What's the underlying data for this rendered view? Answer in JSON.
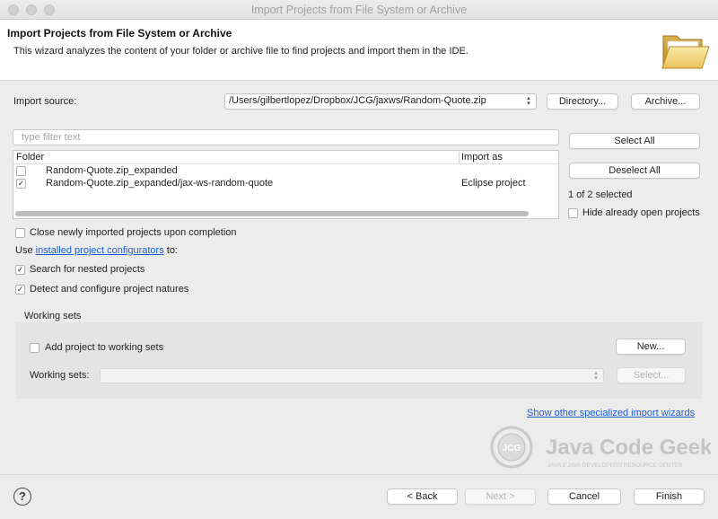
{
  "window": {
    "title": "Import Projects from File System or Archive"
  },
  "header": {
    "title": "Import Projects from File System or Archive",
    "description": "This wizard analyzes the content of your folder or archive file to find projects and import them in the IDE."
  },
  "import_source": {
    "label": "Import source:",
    "value": "/Users/gilbertlopez/Dropbox/JCG/jaxws/Random-Quote.zip",
    "directory_button": "Directory...",
    "archive_button": "Archive..."
  },
  "filter": {
    "placeholder": "type filter text"
  },
  "table": {
    "columns": [
      "Folder",
      "Import as"
    ],
    "rows": [
      {
        "checked": false,
        "folder": "Random-Quote.zip_expanded",
        "import_as": ""
      },
      {
        "checked": true,
        "folder": "Random-Quote.zip_expanded/jax-ws-random-quote",
        "import_as": "Eclipse project"
      }
    ]
  },
  "selection": {
    "select_all": "Select All",
    "deselect_all": "Deselect All",
    "count": "1 of 2 selected",
    "hide_open_label": "Hide already open projects",
    "hide_open_checked": false
  },
  "options": {
    "close_imported_label": "Close newly imported projects upon completion",
    "close_imported_checked": false,
    "use_prefix": "Use ",
    "configurators_link": "installed project configurators",
    "use_suffix": " to:",
    "search_nested_label": "Search for nested projects",
    "search_nested_checked": true,
    "detect_natures_label": "Detect and configure project natures",
    "detect_natures_checked": true
  },
  "working_sets": {
    "group_label": "Working sets",
    "add_label": "Add project to working sets",
    "add_checked": false,
    "new_button": "New...",
    "sets_label": "Working sets:",
    "select_button": "Select..."
  },
  "other_wizards_link": "Show other specialized import wizards",
  "watermark": {
    "badge": "JCG",
    "brand": "Java Code Geeks",
    "tagline": "JAVA 2 JAVA DEVELOPERS RESOURCE CENTER"
  },
  "footer": {
    "back": "< Back",
    "next": "Next >",
    "cancel": "Cancel",
    "finish": "Finish"
  },
  "icons": {
    "help": "?",
    "check": "✓",
    "combo_arrows": "▲▼"
  }
}
